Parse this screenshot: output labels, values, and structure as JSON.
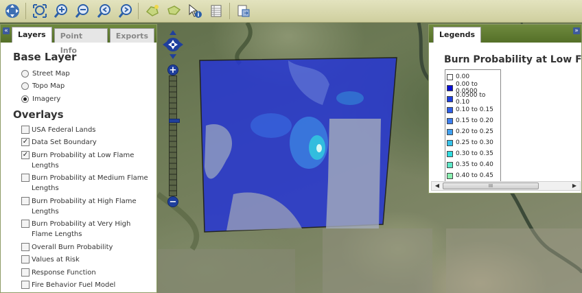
{
  "toolbar": {
    "buttons": [
      {
        "icon": "pan-arrows-icon"
      },
      {
        "icon": "zoom-extent-icon"
      },
      {
        "icon": "zoom-in-icon"
      },
      {
        "icon": "zoom-out-icon"
      },
      {
        "icon": "previous-extent-icon"
      },
      {
        "icon": "next-extent-icon"
      },
      {
        "icon": "select-polygon-icon"
      },
      {
        "icon": "select-region-icon"
      },
      {
        "icon": "identify-icon"
      },
      {
        "icon": "table-icon"
      },
      {
        "icon": "export-map-icon"
      }
    ]
  },
  "layers_panel": {
    "tabs": [
      "Layers",
      "Point Info",
      "Exports"
    ],
    "active_tab": "Layers",
    "base_layer_title": "Base Layer",
    "base_layers": [
      {
        "label": "Street Map",
        "selected": false
      },
      {
        "label": "Topo Map",
        "selected": false
      },
      {
        "label": "Imagery",
        "selected": true
      }
    ],
    "overlays_title": "Overlays",
    "overlays": [
      {
        "label": "USA Federal Lands",
        "checked": false
      },
      {
        "label": "Data Set Boundary",
        "checked": true
      },
      {
        "label": "Burn Probability at Low Flame Lengths",
        "checked": true
      },
      {
        "label": "Burn Probability at Medium Flame Lengths",
        "checked": false
      },
      {
        "label": "Burn Probability at High Flame Lengths",
        "checked": false
      },
      {
        "label": "Burn Probability at Very High Flame Lengths",
        "checked": false
      },
      {
        "label": "Overall Burn Probability",
        "checked": false
      },
      {
        "label": "Values at Risk",
        "checked": false
      },
      {
        "label": "Response Function",
        "checked": false
      },
      {
        "label": "Fire Behavior Fuel Model",
        "checked": false
      }
    ]
  },
  "legends_panel": {
    "tab": "Legends",
    "title": "Burn Probability at Low Flame",
    "entries": [
      {
        "label": "0.00",
        "color": "#ffffff"
      },
      {
        "label": "0.00 to 0.0500",
        "color": "#0a0fd6"
      },
      {
        "label": "0.0500 to 0.10",
        "color": "#1f3fe0"
      },
      {
        "label": "0.10 to 0.15",
        "color": "#2f5fe8"
      },
      {
        "label": "0.15 to 0.20",
        "color": "#3c7ff0"
      },
      {
        "label": "0.20 to 0.25",
        "color": "#3fa0f0"
      },
      {
        "label": "0.25 to 0.30",
        "color": "#35c2ea"
      },
      {
        "label": "0.30 to 0.35",
        "color": "#2fdce0"
      },
      {
        "label": "0.35 to 0.40",
        "color": "#5fe8c8"
      },
      {
        "label": "0.40 to 0.45",
        "color": "#8af0b0"
      }
    ],
    "scroll_thumb_label": "III"
  },
  "map": {
    "overlay_color": "#2a3fe0",
    "zoom_in_label": "+",
    "zoom_out_label": "−"
  }
}
